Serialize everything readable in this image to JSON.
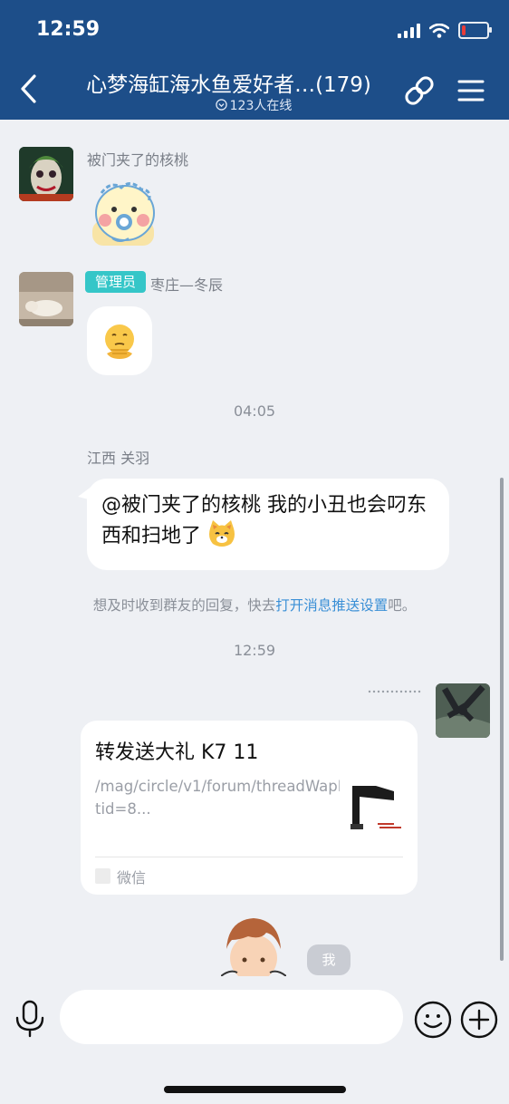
{
  "status_bar": {
    "time": "12:59"
  },
  "header": {
    "title": "心梦海缸海水鱼爱好者…(179)",
    "online_count": "123人在线",
    "icons": [
      "back-arrow-icon",
      "link-icon",
      "menu-icon"
    ]
  },
  "messages": [
    {
      "sender": "被门夹了的核桃",
      "type": "sticker",
      "sticker": "baby-chick-pacifier-sticker"
    },
    {
      "sender": "枣庄—冬辰",
      "role_badge": "管理员",
      "type": "emoji",
      "emoji": "thinking-face-emoji"
    },
    {
      "time_divider": "04:05"
    },
    {
      "sender": "江西 关羽",
      "type": "text",
      "text": "@被门夹了的核桃 我的小丑也会叼东西和扫地了"
    },
    {
      "notice_prefix": "想及时收到群友的回复，快去",
      "notice_link": "打开消息推送设置",
      "notice_suffix": "吧。"
    },
    {
      "time_divider": "12:59"
    },
    {
      "type": "link_card",
      "title": "转发送大礼 K7 11",
      "description": "/mag/circle/v1/forum/threadWapPage?tid=8...",
      "source": "微信"
    },
    {
      "type": "sticker",
      "badge": "我"
    }
  ],
  "colors": {
    "header": "#1d4e89",
    "admin_badge": "#35c6c8",
    "link": "#3a8fd6",
    "background": "#eef0f4"
  },
  "input_bar": {
    "icons": [
      "microphone-icon",
      "emoji-icon",
      "plus-icon"
    ]
  }
}
